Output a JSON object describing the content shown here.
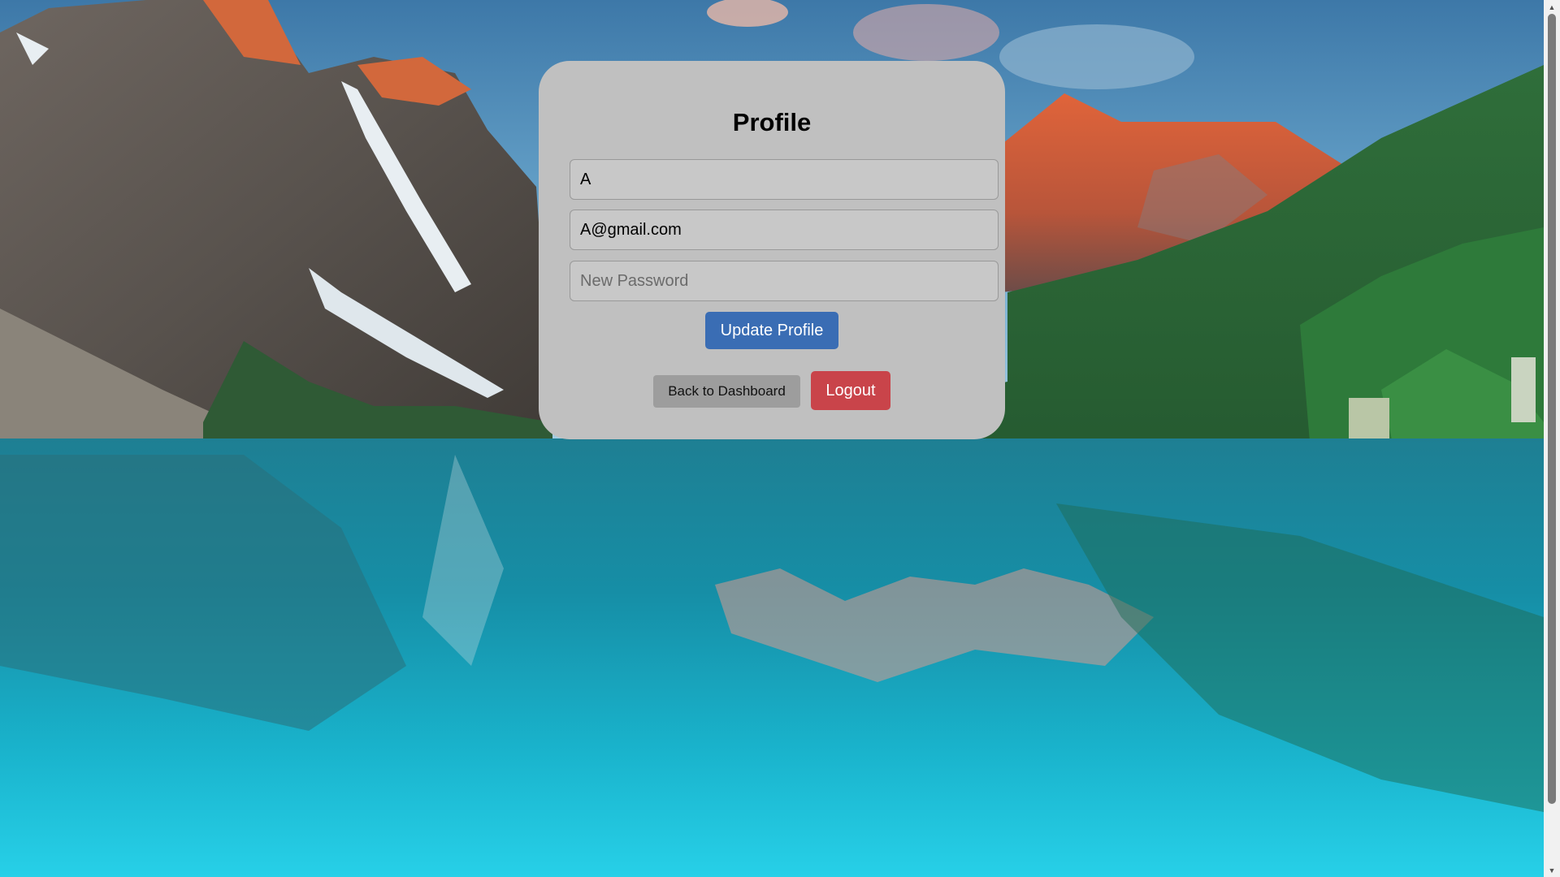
{
  "page": {
    "background": "Moraine Lake mountain landscape"
  },
  "profile": {
    "title": "Profile",
    "name_value": "A",
    "email_value": "A@gmail.com",
    "password_value": "",
    "password_placeholder": "New Password",
    "update_label": "Update Profile",
    "back_label": "Back to Dashboard",
    "logout_label": "Logout"
  },
  "colors": {
    "card_background": "#c0c0c0",
    "update_button": "#3a6db4",
    "back_button": "#9d9d9d",
    "logout_button": "#c9444a"
  },
  "icons": {
    "scroll_up": "scroll-up-arrow-icon",
    "scroll_down": "scroll-down-arrow-icon"
  }
}
